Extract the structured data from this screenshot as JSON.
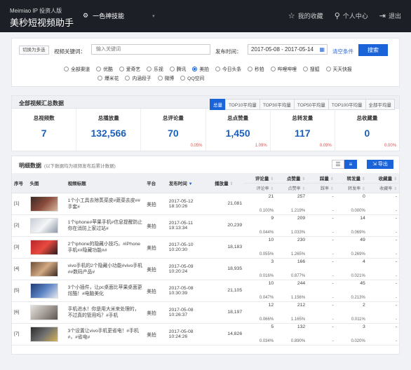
{
  "header": {
    "brand_small": "Meimiao IP 投资人版",
    "brand_big": "美秒短视频助手",
    "skill_label": "一色神技能",
    "skill_dropdown": "▾",
    "nav": [
      {
        "label": "我的收藏",
        "icon": "☆"
      },
      {
        "label": "个人中心",
        "icon": "⚲"
      },
      {
        "label": "退出",
        "icon": "⇥"
      }
    ]
  },
  "filter": {
    "toggle_label": "切换为多选",
    "keyword_label": "视频关键词：",
    "keyword_placeholder": "输入关键词",
    "time_label": "发布时间：",
    "time_value": "2017-05-08 - 2017-05-14",
    "clear_label": "清空条件",
    "search_label": "搜索",
    "platforms": [
      {
        "label": "全部渠道",
        "selected": false
      },
      {
        "label": "优酷",
        "selected": false
      },
      {
        "label": "爱奇艺",
        "selected": false
      },
      {
        "label": "乐视",
        "selected": false
      },
      {
        "label": "腾讯",
        "selected": false
      },
      {
        "label": "美拍",
        "selected": true
      },
      {
        "label": "今日头条",
        "selected": false
      },
      {
        "label": "秒拍",
        "selected": false
      },
      {
        "label": "哔哩哔哩",
        "selected": false
      },
      {
        "label": "搜狐",
        "selected": false
      },
      {
        "label": "天天快报",
        "selected": false
      },
      {
        "label": "爆米花",
        "selected": false
      },
      {
        "label": "内涵段子",
        "selected": false
      },
      {
        "label": "微博",
        "selected": false
      },
      {
        "label": "QQ空间",
        "selected": false
      }
    ]
  },
  "summary": {
    "title": "全部视频汇总数据",
    "tabs": [
      {
        "label": "总量",
        "active": true
      },
      {
        "label": "TOP10平均量",
        "active": false
      },
      {
        "label": "TOP30平均量",
        "active": false
      },
      {
        "label": "TOP50平均量",
        "active": false
      },
      {
        "label": "TOP100平均量",
        "active": false
      },
      {
        "label": "全部平均量",
        "active": false
      }
    ],
    "stats": [
      {
        "label": "总视频数",
        "value": "7",
        "pct": ""
      },
      {
        "label": "总播放量",
        "value": "132,566",
        "pct": ""
      },
      {
        "label": "总评论量",
        "value": "70",
        "pct": "0.05%"
      },
      {
        "label": "总点赞量",
        "value": "1,450",
        "pct": "1.09%"
      },
      {
        "label": "总转发量",
        "value": "117",
        "pct": "0.09%"
      },
      {
        "label": "总收藏量",
        "value": "0",
        "pct": "0.00%"
      }
    ]
  },
  "details": {
    "title": "明细数据",
    "note": "(以下数据均为视频发布后累计数据)",
    "export_label": "导出",
    "columns": {
      "index": "序号",
      "cover": "头图",
      "title": "视频标题",
      "platform": "平台",
      "time": "发布时间",
      "plays": "播放量",
      "comments": "评论量",
      "comment_rate": "评论率",
      "likes": "点赞量",
      "like_rate": "点赞率",
      "dislikes": "踩量",
      "dislike_rate": "踩率",
      "shares": "转发量",
      "share_rate": "转发率",
      "favorites": "收藏量",
      "favorite_rate": "收藏率"
    },
    "rows": [
      {
        "index": "[1]",
        "title": "1个小工具去除蒸菜皮#蔬菜去皮##手套#",
        "platform": "美拍",
        "date": "2017-05-12",
        "time": "18:10:26",
        "plays": "21,081",
        "comments": "21",
        "comment_rate": "0.100%",
        "likes": "257",
        "like_rate": "1.219%",
        "dislikes": "-",
        "dislike_rate": "-",
        "shares": "0",
        "share_rate": "0.000%",
        "favorites": "-",
        "favorite_rate": "-"
      },
      {
        "index": "[2]",
        "title": "1个iphone#苹果手机#信息提醒防止你在消防上家过站#",
        "platform": "美拍",
        "date": "2017-05-11",
        "time": "19:13:34",
        "plays": "20,239",
        "comments": "9",
        "comment_rate": "0.044%",
        "likes": "209",
        "like_rate": "1.033%",
        "dislikes": "-",
        "dislike_rate": "-",
        "shares": "14",
        "share_rate": "0.069%",
        "favorites": "-",
        "favorite_rate": "-"
      },
      {
        "index": "[3]",
        "title": "2个iphone的隐藏小技巧。#iPhone手机##隐藏功能##",
        "platform": "美拍",
        "date": "2017-05-10",
        "time": "10:20:30",
        "plays": "18,183",
        "comments": "10",
        "comment_rate": "0.055%",
        "likes": "230",
        "like_rate": "1.265%",
        "dislikes": "-",
        "dislike_rate": "-",
        "shares": "49",
        "share_rate": "0.269%",
        "favorites": "-",
        "favorite_rate": "-"
      },
      {
        "index": "[4]",
        "title": "vivo手机的2个隐藏小功能#vivo手机##数码产品#",
        "platform": "美拍",
        "date": "2017-05-09",
        "time": "10:20:24",
        "plays": "18,935",
        "comments": "3",
        "comment_rate": "0.016%",
        "likes": "166",
        "like_rate": "0.877%",
        "dislikes": "-",
        "dislike_rate": "-",
        "shares": "4",
        "share_rate": "0.021%",
        "favorites": "-",
        "favorite_rate": "-"
      },
      {
        "index": "[5]",
        "title": "3个小插件，让pc桌面比苹果桌面更炫酷！#电脑美化",
        "platform": "美拍",
        "date": "2017-05-08",
        "time": "10:30:39",
        "plays": "21,105",
        "comments": "10",
        "comment_rate": "0.047%",
        "likes": "244",
        "like_rate": "1.156%",
        "dislikes": "-",
        "dislike_rate": "-",
        "shares": "45",
        "share_rate": "0.213%",
        "favorites": "-",
        "favorite_rate": "-"
      },
      {
        "index": "[6]",
        "title": "手机进水！你是用大米来处理的，不过真的管用吗？#手机",
        "platform": "美拍",
        "date": "2017-05-08",
        "time": "10:26:37",
        "plays": "18,197",
        "comments": "12",
        "comment_rate": "0.066%",
        "likes": "212",
        "like_rate": "1.165%",
        "dislikes": "-",
        "dislike_rate": "-",
        "shares": "2",
        "share_rate": "0.011%",
        "favorites": "-",
        "favorite_rate": "-"
      },
      {
        "index": "[7]",
        "title": "3个设置让vivo手机更省电！#手机#，#省电#",
        "platform": "美拍",
        "date": "2017-05-08",
        "time": "10:24:26",
        "plays": "14,826",
        "comments": "5",
        "comment_rate": "0.034%",
        "likes": "132",
        "like_rate": "0.890%",
        "dislikes": "-",
        "dislike_rate": "-",
        "shares": "3",
        "share_rate": "0.020%",
        "favorites": "-",
        "favorite_rate": "-"
      }
    ]
  }
}
